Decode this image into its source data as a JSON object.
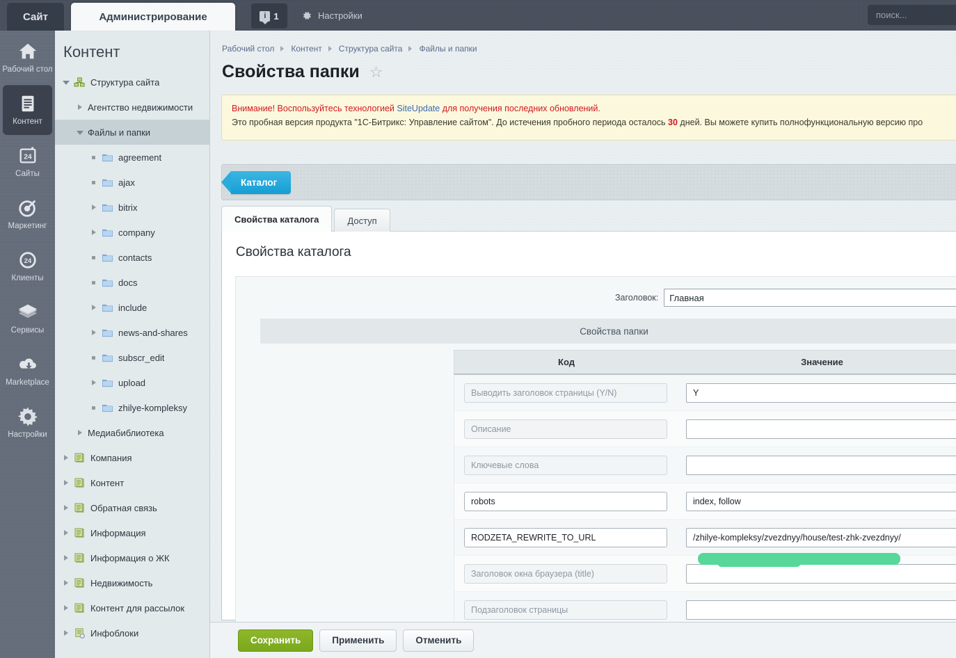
{
  "topbar": {
    "site_tab": "Сайт",
    "admin_tab": "Администрирование",
    "notify_count": "1",
    "notify_icon": "info-square-icon",
    "settings_label": "Настройки",
    "settings_icon": "gear-icon",
    "search_placeholder": "поиск..."
  },
  "rail": {
    "items": [
      {
        "label": "Рабочий стол",
        "icon": "home-icon",
        "active": false
      },
      {
        "label": "Контент",
        "icon": "document-icon",
        "active": true
      },
      {
        "label": "Сайты",
        "icon": "browser-24-icon",
        "active": false
      },
      {
        "label": "Маркетинг",
        "icon": "target-icon",
        "active": false
      },
      {
        "label": "Клиенты",
        "icon": "circle-24-icon",
        "active": false
      },
      {
        "label": "Сервисы",
        "icon": "layers-icon",
        "active": false
      },
      {
        "label": "Marketplace",
        "icon": "cloud-download-icon",
        "active": false
      },
      {
        "label": "Настройки",
        "icon": "gear-icon",
        "active": false
      }
    ]
  },
  "tree": {
    "title": "Контент",
    "nodes": [
      {
        "label": "Структура сайта",
        "indent": 0,
        "toggle": "down",
        "icon": "sitemap-icon",
        "selected": false
      },
      {
        "label": "Агентство недвижимости",
        "indent": 1,
        "toggle": "right",
        "icon": "none",
        "selected": false
      },
      {
        "label": "Файлы и папки",
        "indent": 1,
        "toggle": "down",
        "icon": "none",
        "selected": true
      },
      {
        "label": "agreement",
        "indent": 2,
        "toggle": "dot",
        "icon": "folder-icon",
        "selected": false
      },
      {
        "label": "ajax",
        "indent": 2,
        "toggle": "dot",
        "icon": "folder-icon",
        "selected": false
      },
      {
        "label": "bitrix",
        "indent": 2,
        "toggle": "right",
        "icon": "folder-icon",
        "selected": false
      },
      {
        "label": "company",
        "indent": 2,
        "toggle": "right",
        "icon": "folder-icon",
        "selected": false
      },
      {
        "label": "contacts",
        "indent": 2,
        "toggle": "dot",
        "icon": "folder-icon",
        "selected": false
      },
      {
        "label": "docs",
        "indent": 2,
        "toggle": "dot",
        "icon": "folder-icon",
        "selected": false
      },
      {
        "label": "include",
        "indent": 2,
        "toggle": "right",
        "icon": "folder-icon",
        "selected": false
      },
      {
        "label": "news-and-shares",
        "indent": 2,
        "toggle": "right",
        "icon": "folder-icon",
        "selected": false
      },
      {
        "label": "subscr_edit",
        "indent": 2,
        "toggle": "dot",
        "icon": "folder-icon",
        "selected": false
      },
      {
        "label": "upload",
        "indent": 2,
        "toggle": "right",
        "icon": "folder-icon",
        "selected": false
      },
      {
        "label": "zhilye-kompleksy",
        "indent": 2,
        "toggle": "dot",
        "icon": "folder-icon",
        "selected": false
      },
      {
        "label": "Медиабиблиотека",
        "indent": 1,
        "toggle": "right",
        "icon": "none",
        "selected": false
      },
      {
        "label": "Компания",
        "indent": 0,
        "toggle": "right",
        "icon": "iblock-icon",
        "selected": false
      },
      {
        "label": "Контент",
        "indent": 0,
        "toggle": "right",
        "icon": "iblock-icon",
        "selected": false
      },
      {
        "label": "Обратная связь",
        "indent": 0,
        "toggle": "right",
        "icon": "iblock-icon",
        "selected": false
      },
      {
        "label": "Информация",
        "indent": 0,
        "toggle": "right",
        "icon": "iblock-icon",
        "selected": false
      },
      {
        "label": "Информация о ЖК",
        "indent": 0,
        "toggle": "right",
        "icon": "iblock-icon",
        "selected": false
      },
      {
        "label": "Недвижимость",
        "indent": 0,
        "toggle": "right",
        "icon": "iblock-icon",
        "selected": false
      },
      {
        "label": "Контент для рассылок",
        "indent": 0,
        "toggle": "right",
        "icon": "iblock-icon",
        "selected": false
      },
      {
        "label": "Инфоблоки",
        "indent": 0,
        "toggle": "right",
        "icon": "iblock-cog-icon",
        "selected": false
      }
    ]
  },
  "breadcrumb": [
    "Рабочий стол",
    "Контент",
    "Структура сайта",
    "Файлы и папки"
  ],
  "page": {
    "title": "Свойства папки",
    "favorite_icon": "star-outline-icon"
  },
  "warning": {
    "line1_pre": "Внимание! Воспользуйтесь технологией ",
    "line1_link": "SiteUpdate",
    "line1_post": " для получения последних обновлений.",
    "line2_pre": "Это пробная версия продукта \"1С-Битрикс: Управление сайтом\". До истечения пробного периода осталось ",
    "line2_days": "30",
    "line2_post": " дней. Вы можете купить полнофункциональную версию про"
  },
  "toolbar": {
    "catalog_button": "Каталог"
  },
  "tabs": [
    {
      "label": "Свойства каталога",
      "active": true
    },
    {
      "label": "Доступ",
      "active": false
    }
  ],
  "form": {
    "heading": "Свойства каталога",
    "title_label": "Заголовок:",
    "title_value": "Главная",
    "section_band": "Свойства папки",
    "col_code": "Код",
    "col_value": "Значение",
    "rows": [
      {
        "code": "",
        "code_placeholder": "Выводить заголовок страницы (Y/N)",
        "value": "Y"
      },
      {
        "code": "",
        "code_placeholder": "Описание",
        "value": ""
      },
      {
        "code": "",
        "code_placeholder": "Ключевые слова",
        "value": ""
      },
      {
        "code": "robots",
        "code_placeholder": "",
        "value": "index, follow"
      },
      {
        "code": "RODZETA_REWRITE_TO_URL",
        "code_placeholder": "",
        "value": "/zhilye-kompleksy/zvezdnyy/house/test-zhk-zvezdnyy/"
      },
      {
        "code": "",
        "code_placeholder": "Заголовок окна браузера (title)",
        "value": ""
      },
      {
        "code": "",
        "code_placeholder": "Подзаголовок страницы",
        "value": ""
      }
    ]
  },
  "buttons": {
    "save": "Сохранить",
    "apply": "Применить",
    "cancel": "Отменить"
  },
  "colors": {
    "accent_blue": "#2aabdc",
    "save_green": "#7aa81c",
    "highlight_green": "#57d79a",
    "warning_bg": "#fbf8dd",
    "warning_red": "#d4181f"
  }
}
